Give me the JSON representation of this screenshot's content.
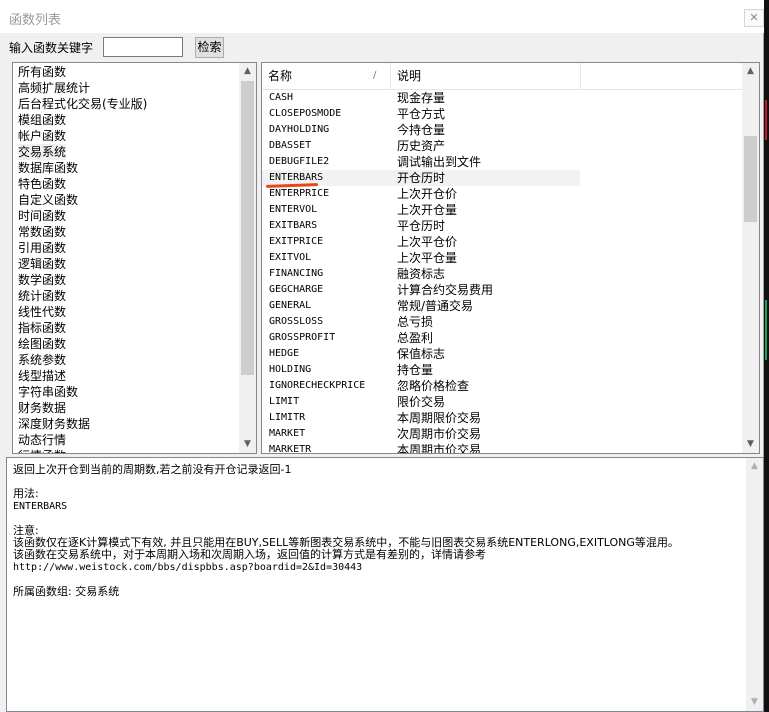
{
  "window": {
    "title": "函数列表",
    "close_icon": "✕"
  },
  "search": {
    "label": "输入函数关键字",
    "value": "",
    "button": "检索"
  },
  "categories": [
    "所有函数",
    "高频扩展统计",
    "后台程式化交易(专业版)",
    "模组函数",
    "帐户函数",
    "交易系统",
    "数据库函数",
    "特色函数",
    "自定义函数",
    "时间函数",
    "常数函数",
    "引用函数",
    "逻辑函数",
    "数学函数",
    "统计函数",
    "线性代数",
    "指标函数",
    "绘图函数",
    "系统参数",
    "线型描述",
    "字符串函数",
    "财务数据",
    "深度财务数据",
    "动态行情",
    "行情函数"
  ],
  "selected_category": "交易系统",
  "columns": {
    "name": "名称",
    "desc": "说明",
    "sort_icon": "/"
  },
  "functions": [
    {
      "name": "CASH",
      "desc": "现金存量"
    },
    {
      "name": "CLOSEPOSMODE",
      "desc": "平仓方式"
    },
    {
      "name": "DAYHOLDING",
      "desc": "今持仓量"
    },
    {
      "name": "DBASSET",
      "desc": "历史资产"
    },
    {
      "name": "DEBUGFILE2",
      "desc": "调试输出到文件"
    },
    {
      "name": "ENTERBARS",
      "desc": "开仓历时"
    },
    {
      "name": "ENTERPRICE",
      "desc": "上次开仓价"
    },
    {
      "name": "ENTERVOL",
      "desc": "上次开仓量"
    },
    {
      "name": "EXITBARS",
      "desc": "平仓历时"
    },
    {
      "name": "EXITPRICE",
      "desc": "上次平仓价"
    },
    {
      "name": "EXITVOL",
      "desc": "上次平仓量"
    },
    {
      "name": "FINANCING",
      "desc": "融资标志"
    },
    {
      "name": "GEGCHARGE",
      "desc": "计算合约交易费用"
    },
    {
      "name": "GENERAL",
      "desc": "常规/普通交易"
    },
    {
      "name": "GROSSLOSS",
      "desc": "总亏损"
    },
    {
      "name": "GROSSPROFIT",
      "desc": "总盈利"
    },
    {
      "name": "HEDGE",
      "desc": "保值标志"
    },
    {
      "name": "HOLDING",
      "desc": "持仓量"
    },
    {
      "name": "IGNORECHECKPRICE",
      "desc": "忽略价格检查"
    },
    {
      "name": "LIMIT",
      "desc": "限价交易"
    },
    {
      "name": "LIMITR",
      "desc": "本周期限价交易"
    },
    {
      "name": "MARKET",
      "desc": "次周期市价交易"
    },
    {
      "name": "MARKETR",
      "desc": "本周期市价交易"
    }
  ],
  "selected_function": "ENTERBARS",
  "description": [
    "返回上次开仓到当前的周期数,若之前没有开仓记录返回-1",
    "",
    "用法:",
    "ENTERBARS",
    "",
    "注意:",
    "该函数仅在逐K计算模式下有效, 并且只能用在BUY,SELL等新图表交易系统中，不能与旧图表交易系统ENTERLONG,EXITLONG等混用。",
    "该函数在交易系统中，对于本周期入场和次周期入场，返回值的计算方式是有差别的，详情请参考",
    "http://www.weistock.com/bbs/dispbbs.asp?boardid=2&Id=30443",
    "",
    "所属函数组: 交易系统"
  ],
  "icons": {
    "scroll_up": "▲",
    "scroll_down": "▼"
  },
  "colors": {
    "highlight_underline": "#e8471c",
    "selection_bg": "#f2f2f2"
  }
}
